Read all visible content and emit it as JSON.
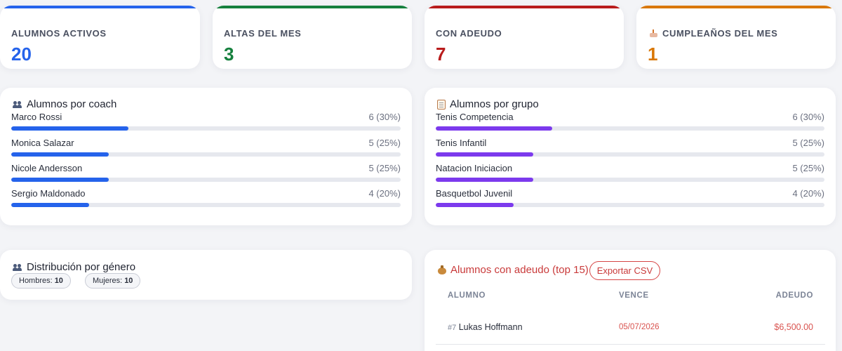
{
  "stats": [
    {
      "label": "ALUMNOS ACTIVOS",
      "value": "20",
      "color": "#2563eb",
      "icon": ""
    },
    {
      "label": "ALTAS DEL MES",
      "value": "3",
      "color": "#15803d",
      "icon": ""
    },
    {
      "label": "CON ADEUDO",
      "value": "7",
      "color": "#b91c1c",
      "icon": ""
    },
    {
      "label": "CUMPLEAÑOS DEL MES",
      "value": "1",
      "color": "#d97706",
      "icon": "birthday-cake-icon"
    }
  ],
  "coach_section": {
    "title": "Alumnos por coach",
    "icon": "people-icon",
    "bar_color": "#2563eb",
    "rows": [
      {
        "name": "Marco Rossi",
        "count": "6 (30%)",
        "share": 0.3
      },
      {
        "name": "Monica Salazar",
        "count": "5 (25%)",
        "share": 0.25
      },
      {
        "name": "Nicole Andersson",
        "count": "5 (25%)",
        "share": 0.25
      },
      {
        "name": "Sergio Maldonado",
        "count": "4 (20%)",
        "share": 0.2
      }
    ]
  },
  "group_section": {
    "title": "Alumnos por grupo",
    "icon": "clipboard-icon",
    "bar_color": "#7c3aed",
    "rows": [
      {
        "name": "Tenis Competencia",
        "count": "6 (30%)",
        "share": 0.3
      },
      {
        "name": "Tenis Infantil",
        "count": "5 (25%)",
        "share": 0.25
      },
      {
        "name": "Natacion Iniciacion",
        "count": "5 (25%)",
        "share": 0.25
      },
      {
        "name": "Basquetbol Juvenil",
        "count": "4 (20%)",
        "share": 0.2
      }
    ]
  },
  "gender_section": {
    "title": "Distribución por género",
    "icon": "people-icon",
    "pills": [
      {
        "label": "Hombres:",
        "value": "10"
      },
      {
        "label": "Mujeres:",
        "value": "10"
      }
    ]
  },
  "debt_section": {
    "title": "Alumnos con adeudo (top 15)",
    "icon": "money-bag-icon",
    "title_color": "#c93a3a",
    "export_label": "Exportar CSV",
    "columns": [
      "ALUMNO",
      "VENCE",
      "ADEUDO"
    ],
    "rows": [
      {
        "id": "#7",
        "name": "Lukas Hoffmann",
        "due": "05/07/2026",
        "amount": "$6,500.00"
      }
    ]
  }
}
